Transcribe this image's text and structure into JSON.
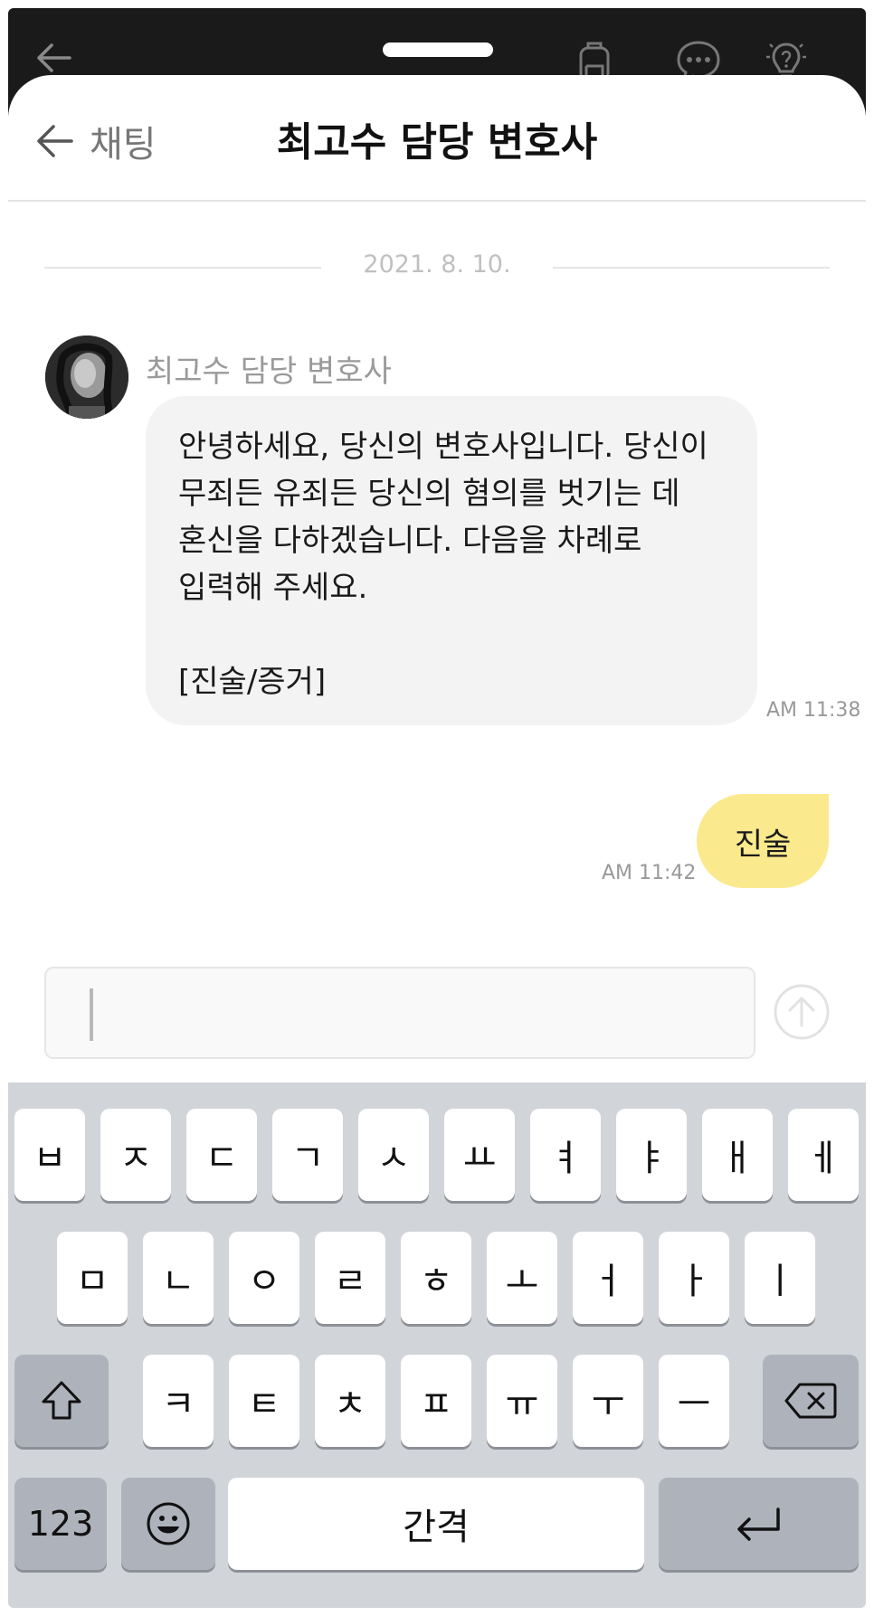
{
  "header": {
    "back_label": "채팅",
    "title": "최고수 담당 변호사"
  },
  "chat": {
    "date": "2021. 8. 10.",
    "sender_name": "최고수 담당 변호사",
    "incoming_message": "안녕하세요, 당신의 변호사입니다. 당신이 무죄든 유죄든 당신의 혐의를 벗기는 데 혼신을 다하겠습니다. 다음을 차례로 입력해 주세요.\n\n[진술/증거]",
    "incoming_time": "AM 11:38",
    "outgoing_message": "진술",
    "outgoing_time": "AM 11:42"
  },
  "composer": {
    "value": ""
  },
  "keyboard": {
    "row1": [
      "ㅂ",
      "ㅈ",
      "ㄷ",
      "ㄱ",
      "ㅅ",
      "ㅛ",
      "ㅕ",
      "ㅑ",
      "ㅐ",
      "ㅔ"
    ],
    "row2": [
      "ㅁ",
      "ㄴ",
      "ㅇ",
      "ㄹ",
      "ㅎ",
      "ㅗ",
      "ㅓ",
      "ㅏ",
      "ㅣ"
    ],
    "row3": [
      "ㅋ",
      "ㅌ",
      "ㅊ",
      "ㅍ",
      "ㅠ",
      "ㅜ",
      "ㅡ"
    ],
    "numbers_label": "123",
    "space_label": "간격"
  },
  "colors": {
    "outgoing_bubble": "#fbe98d",
    "incoming_bubble": "#f3f3f3",
    "topbar": "#1a1a1a"
  }
}
